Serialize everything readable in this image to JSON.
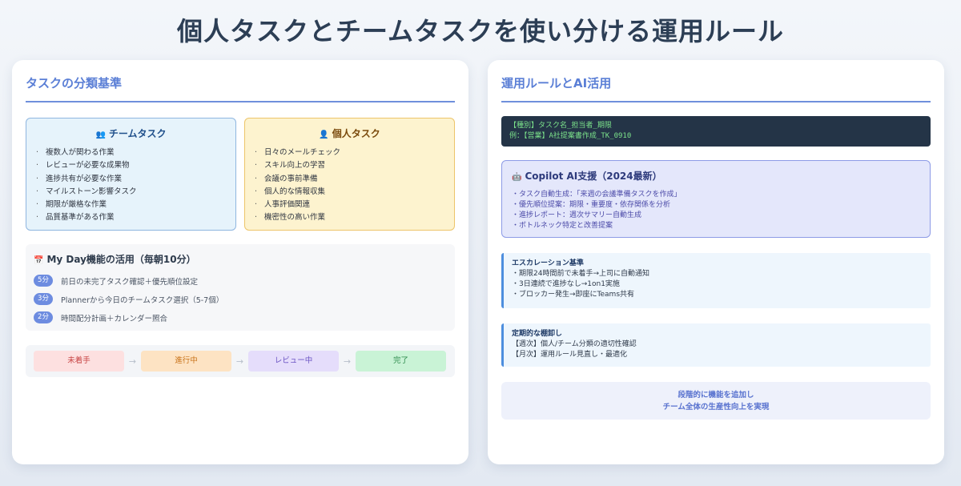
{
  "title": "個人タスクとチームタスクを使い分ける運用ルール",
  "left_panel": {
    "heading": "タスクの分類基準",
    "team": {
      "icon": "👥",
      "title": "チームタスク",
      "items": [
        "複数人が関わる作業",
        "レビューが必要な成果物",
        "進捗共有が必要な作業",
        "マイルストーン影響タスク",
        "期限が厳格な作業",
        "品質基準がある作業"
      ]
    },
    "personal": {
      "icon": "👤",
      "title": "個人タスク",
      "items": [
        "日々のメールチェック",
        "スキル向上の学習",
        "会議の事前準備",
        "個人的な情報収集",
        "人事評価関連",
        "機密性の高い作業"
      ]
    },
    "myday": {
      "icon": "📅",
      "title": "My Day機能の活用（毎朝10分）",
      "steps": [
        {
          "time": "5分",
          "text": "前日の未完了タスク確認＋優先順位設定"
        },
        {
          "time": "3分",
          "text": "Plannerから今日のチームタスク選択（5-7個）"
        },
        {
          "time": "2分",
          "text": "時間配分計画＋カレンダー照合"
        }
      ]
    },
    "flow": {
      "arrow": "→",
      "stages": [
        "未着手",
        "進行中",
        "レビュー中",
        "完了"
      ]
    }
  },
  "right_panel": {
    "heading": "運用ルールとAI活用",
    "naming": {
      "line1": "【種別】タスク名_担当者_期限",
      "line2": "例：【営業】A社提案書作成_TK_0910"
    },
    "copilot": {
      "icon": "🤖",
      "title": "Copilot AI支援（2024最新）",
      "items": [
        "・タスク自動生成：「来週の会議準備タスクを作成」",
        "・優先順位提案：期限・重要度・依存関係を分析",
        "・進捗レポート：週次サマリー自動生成",
        "・ボトルネック特定と改善提案"
      ]
    },
    "escalation": {
      "title": "エスカレーション基準",
      "items": [
        "・期限24時間前で未着手→上司に自動通知",
        "・3日連続で進捗なし→1on1実施",
        "・ブロッカー発生→即座にTeams共有"
      ]
    },
    "review": {
      "title": "定期的な棚卸し",
      "items": [
        "【週次】個人/チーム分類の適切性確認",
        "【月次】運用ルール見直し・最適化"
      ]
    },
    "summary": {
      "line1": "段階的に機能を追加し",
      "line2": "チーム全体の生産性向上を実現"
    }
  }
}
